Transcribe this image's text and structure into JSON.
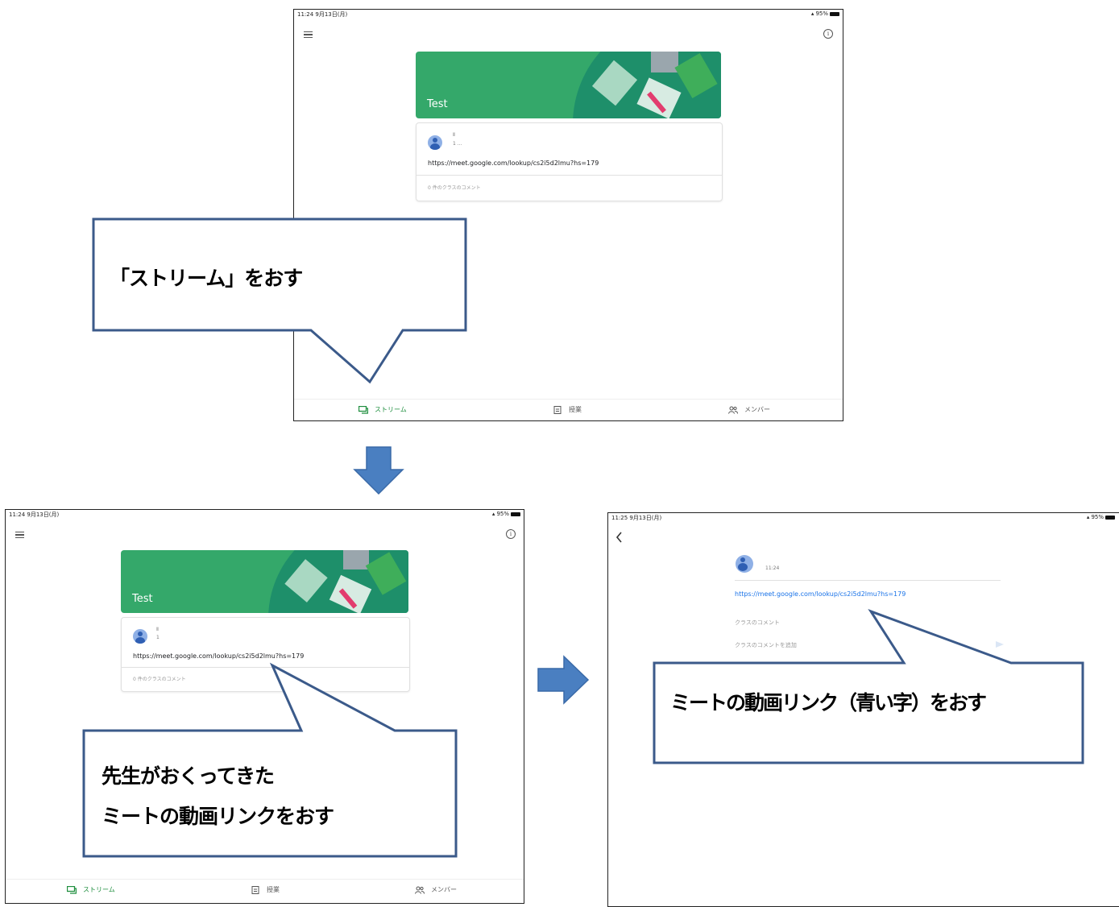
{
  "screens": [
    {
      "status_time": "11:24 9月13日(月)",
      "status_battery": "95%",
      "class_title": "Test",
      "post_name": "Ⅱ",
      "post_time": "1 ...",
      "post_link": "https://meet.google.com/lookup/cs2i5d2lmu?hs=179",
      "comment_summary": "0 件のクラスのコメント",
      "nav": [
        "ストリーム",
        "授業",
        "メンバー"
      ]
    },
    {
      "status_time": "11:24 9月13日(月)",
      "status_battery": "95%",
      "class_title": "Test",
      "post_name": "Ⅱ",
      "post_time": "1",
      "post_link": "https://meet.google.com/lookup/cs2i5d2lmu?hs=179",
      "comment_summary": "0 件のクラスのコメント",
      "nav": [
        "ストリーム",
        "授業",
        "メンバー"
      ]
    },
    {
      "status_time": "11:25 9月13日(月)",
      "status_battery": "95%",
      "post_time": "11:24",
      "post_link": "https://meet.google.com/lookup/cs2i5d2lmu?hs=179",
      "class_comments_label": "クラスのコメント",
      "add_comment_placeholder": "クラスのコメントを追加"
    }
  ],
  "callouts": {
    "step1": "「ストリーム」をおす",
    "step2_line1": "先生がおくってきた",
    "step2_line2": "ミートの動画リンクをおす",
    "step3": "ミートの動画リンク（青い字）をおす"
  },
  "colors": {
    "banner_green": "#34a86a",
    "banner_dark": "#1e8f6a",
    "arrow_blue": "#4a7fc1",
    "callout_border": "#3b5a8a",
    "link_blue": "#1a73e8",
    "active_nav": "#1e8e3e"
  }
}
